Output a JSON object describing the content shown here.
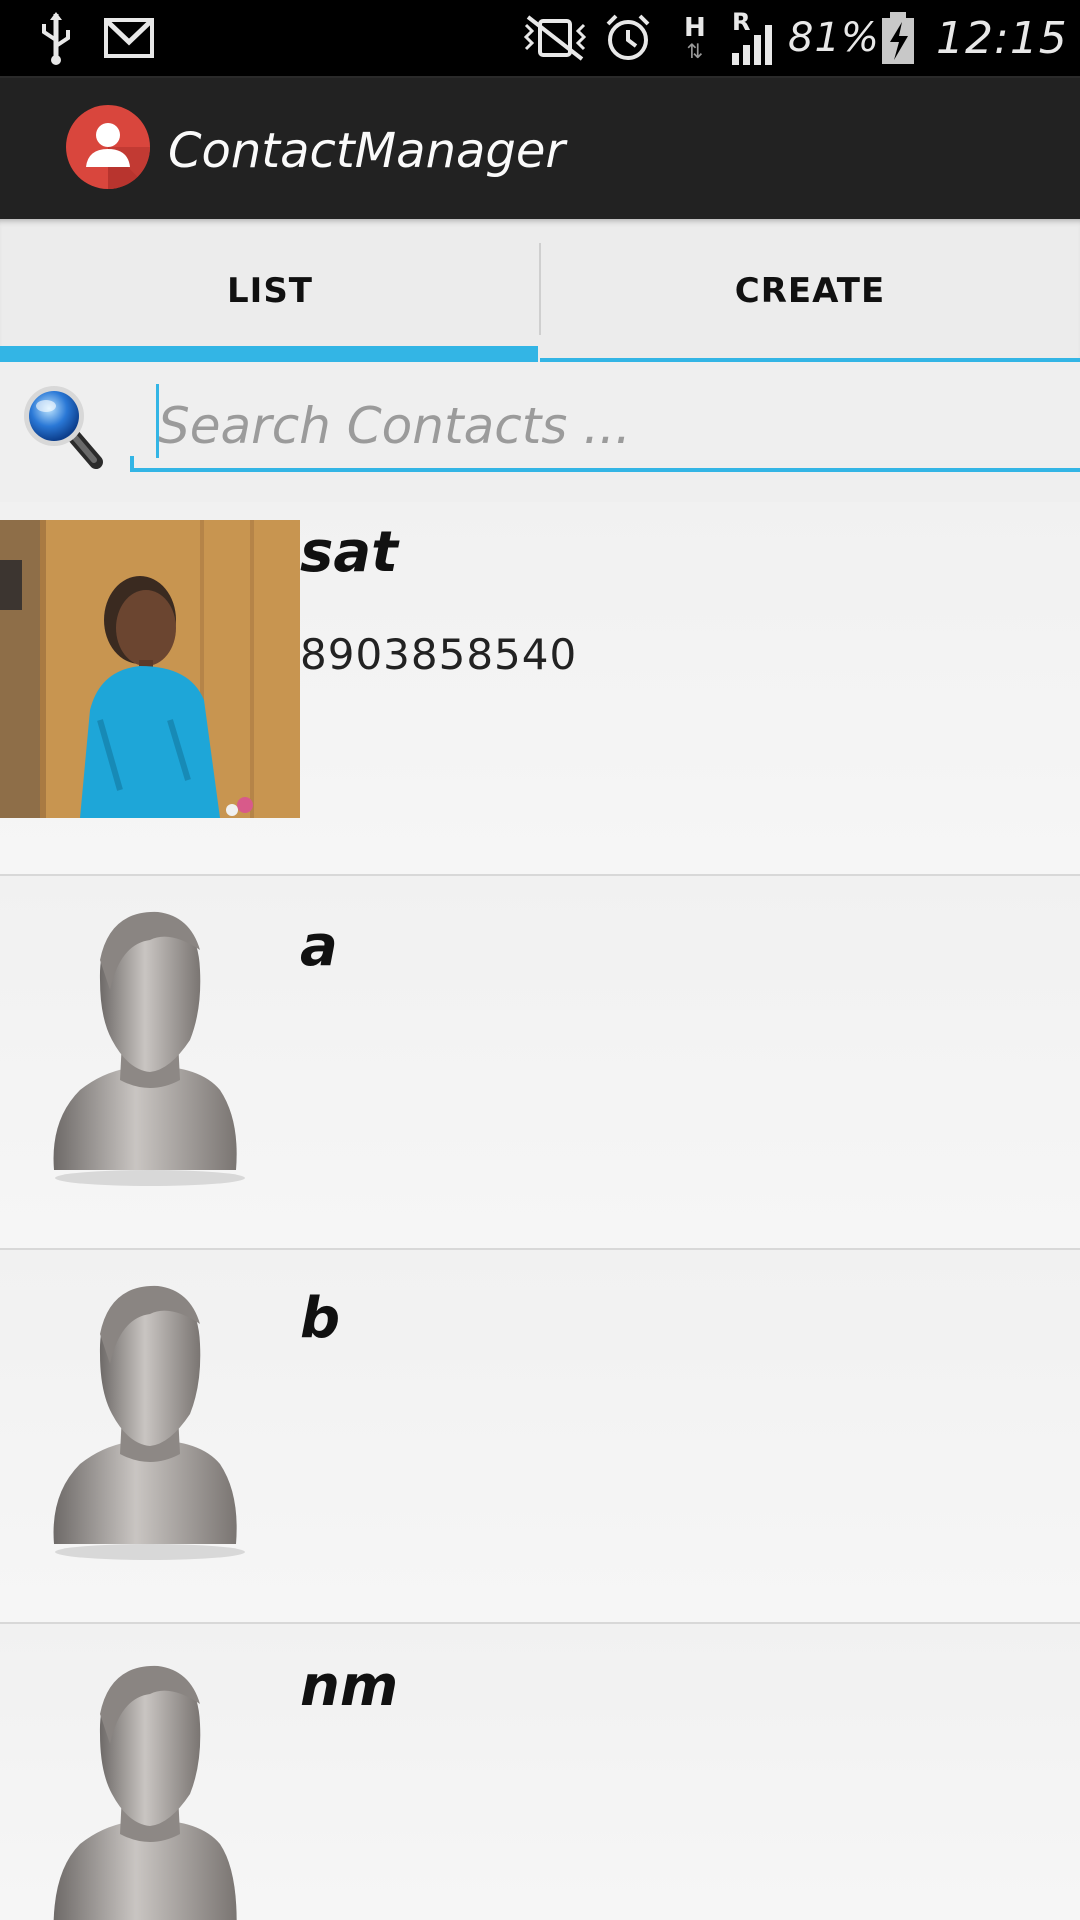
{
  "status_bar": {
    "battery": "81%",
    "time": "12:15",
    "network": "H",
    "roaming": "R"
  },
  "app": {
    "title": "ContactManager"
  },
  "tabs": [
    {
      "label": "LIST",
      "active": true
    },
    {
      "label": "CREATE",
      "active": false
    }
  ],
  "search": {
    "placeholder": "Search Contacts ...",
    "value": ""
  },
  "contacts": [
    {
      "name": "sat",
      "phone": "8903858540",
      "avatar": "photo"
    },
    {
      "name": "a",
      "phone": "",
      "avatar": "default-person-icon"
    },
    {
      "name": "b",
      "phone": "",
      "avatar": "default-person-icon"
    },
    {
      "name": "nm",
      "phone": "",
      "avatar": "default-person-icon"
    }
  ],
  "colors": {
    "accent": "#33b5e5",
    "action_bar": "#222222",
    "logo": "#d9463d"
  }
}
